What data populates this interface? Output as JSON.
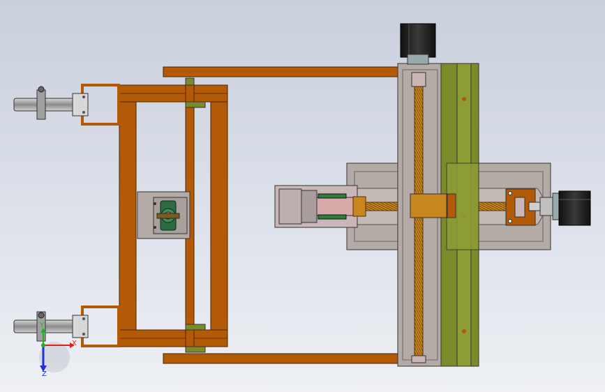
{
  "app": {
    "view": "top",
    "colors": {
      "background_top": "#c9cfdb",
      "background_bottom": "#eef0f4",
      "frame_wood": "#b35a06",
      "frame_wood_dark": "#8a4204",
      "rail_olive": "#7c8b2a",
      "metal_gray": "#b0a6a2",
      "screw_bronze": "#c8861f",
      "motor_black": "#222222",
      "bearing_green": "#3a8f5c"
    }
  },
  "triad": {
    "x_label": "X",
    "y_label": "Y",
    "z_label": "Z",
    "x_color": "#e02020",
    "y_color": "#20b020",
    "z_color": "#2030d0"
  }
}
